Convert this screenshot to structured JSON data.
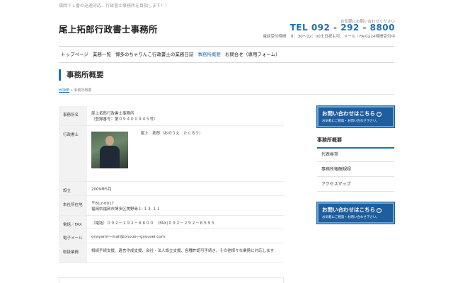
{
  "header": {
    "tagline": "福岡で１番の迅速対応、行政書士事務所を目指します！！",
    "site_title": "尾上拓郎行政書士事務所",
    "contact_note": "お気軽にお問い合わせください",
    "tel": "TEL 092 - 292 - 8800",
    "hours": "電話受付時間　８：30〜22：00土日祝も可、メール・FAXは24時間受付中"
  },
  "gnav": {
    "items": [
      {
        "label": "トップページ"
      },
      {
        "label": "業務一覧"
      },
      {
        "label": "博多のちゃりんこ行政書士の業務日誌"
      },
      {
        "label": "事務所概要"
      },
      {
        "label": "お問合せ（専用フォーム）"
      }
    ],
    "active_index": 3
  },
  "page": {
    "title": "事務所概要",
    "breadcrumb": {
      "home": "HOME",
      "separator": "»",
      "current": "事務所概要"
    }
  },
  "office_table": {
    "name": {
      "label": "事務所名",
      "line1": "尾上拓郎行政書士事務所",
      "line2": "（登録番号：第０９４００９４５号）"
    },
    "rep": {
      "label": "行政書士",
      "name": "尾上　拓郎（おのうえ　たくろう）"
    },
    "established": {
      "label": "設立",
      "value": "2009年5月"
    },
    "address": {
      "label": "本社所在地",
      "line1": "〒812-0017",
      "line2": "福岡県福岡市博多区美野島１-１３-１１"
    },
    "phone": {
      "label": "電話／FAX",
      "value": "（電話）０９２－２９２－８８００　（FAX)０９２－２９２－８５９５"
    },
    "email": {
      "label": "電子メール",
      "value": "onayami—mail@onoue—gyousei.com"
    },
    "business": {
      "label": "取扱業務",
      "value": "相続手続支援、遺言作成支援、会社・法人設立支援、各種許認可手続き、その他様々な業務に対応します"
    }
  },
  "sidebar": {
    "banner": {
      "title": "お問い合わせはこちら",
      "subtitle": "お気軽にご相談・お問い合わせ下さい。"
    },
    "menu_title": "事務所概要",
    "menu": [
      {
        "label": "代表挨拶"
      },
      {
        "label": "事務所報酬規程"
      },
      {
        "label": "アクセスマップ"
      }
    ]
  },
  "colors": {
    "accent": "#1e6fb5",
    "banner": "#1f5e9e"
  },
  "icons": {
    "banner_arrow": "circle-arrow-icon"
  }
}
